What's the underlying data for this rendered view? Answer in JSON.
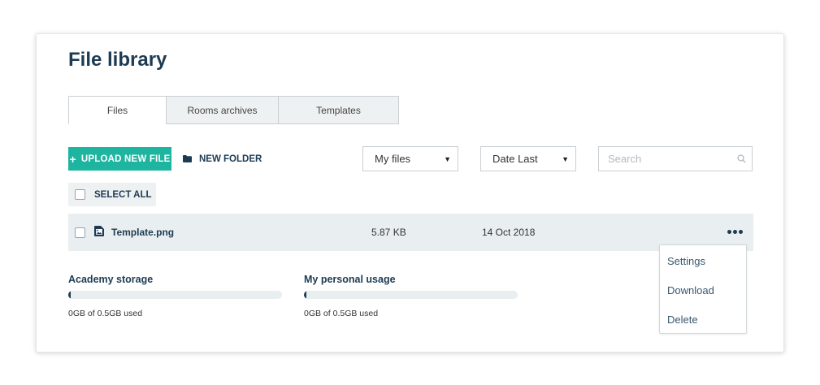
{
  "header": {
    "title": "File library"
  },
  "tabs": [
    {
      "label": "Files",
      "active": true
    },
    {
      "label": "Rooms archives",
      "active": false
    },
    {
      "label": "Templates",
      "active": false
    }
  ],
  "toolbar": {
    "upload_label": "UPLOAD NEW FILE",
    "new_folder_label": "NEW FOLDER",
    "owner_filter": {
      "selected": "My files"
    },
    "sort": {
      "selected": "Date Last"
    },
    "search": {
      "placeholder": "Search",
      "value": ""
    }
  },
  "select_all_label": "SELECT ALL",
  "files": [
    {
      "name": "Template.png",
      "size": "5.87 KB",
      "date": "14 Oct 2018"
    }
  ],
  "context_menu": {
    "items": [
      "Settings",
      "Download",
      "Delete"
    ]
  },
  "storage": {
    "academy": {
      "title": "Academy storage",
      "usage_text": "0GB of 0.5GB used",
      "fraction": 0.0
    },
    "personal": {
      "title": "My personal usage",
      "usage_text": "0GB of 0.5GB used",
      "fraction": 0.0
    }
  },
  "colors": {
    "accent": "#1eb5a0",
    "title": "#1d3b53",
    "row_background": "#e9eef0"
  },
  "icons": {
    "upload": "plus-icon",
    "new_folder": "folder-icon",
    "search": "search-icon",
    "file": "image-file-icon",
    "more": "more-horizontal-icon",
    "select_caret": "caret-down-icon"
  }
}
